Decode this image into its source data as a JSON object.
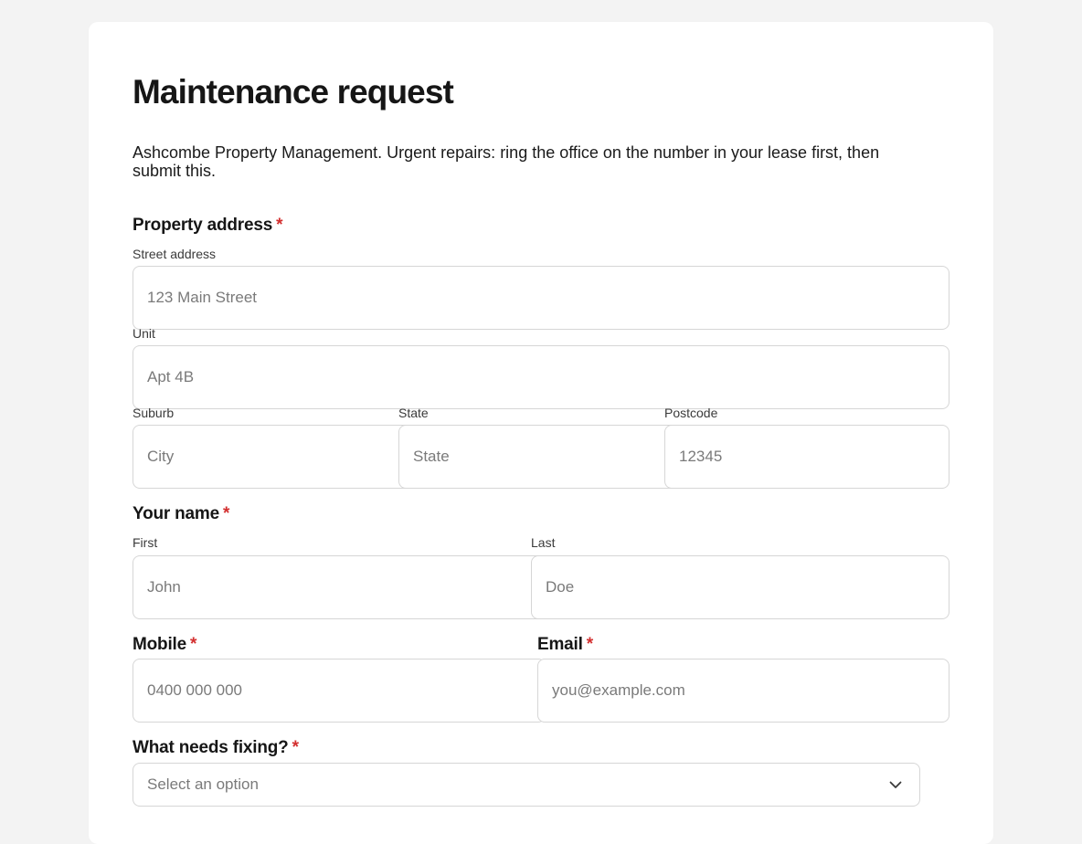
{
  "form": {
    "title": "Maintenance request",
    "intro": "Ashcombe Property Management. Urgent repairs: ring the office on the number in your lease first, then submit this.",
    "required_marker": "*",
    "property": {
      "label": "Property address",
      "street_label": "Street address",
      "street_placeholder": "123 Main Street",
      "unit_label": "Unit",
      "unit_placeholder": "Apt 4B",
      "suburb_label": "Suburb",
      "suburb_placeholder": "City",
      "state_label": "State",
      "state_placeholder": "State",
      "postcode_label": "Postcode",
      "postcode_placeholder": "12345"
    },
    "name": {
      "label": "Your name",
      "first_label": "First",
      "first_placeholder": "John",
      "last_label": "Last",
      "last_placeholder": "Doe"
    },
    "mobile": {
      "label": "Mobile",
      "placeholder": "0400 000 000"
    },
    "email": {
      "label": "Email",
      "placeholder": "you@example.com"
    },
    "fixing": {
      "label": "What needs fixing?",
      "selected": "Select an option",
      "icon": "chevron-down-icon"
    }
  },
  "colors": {
    "required": "#d32f2f",
    "page_background": "#f3f3f3",
    "card_background": "#ffffff",
    "border": "#d6d6d6"
  }
}
